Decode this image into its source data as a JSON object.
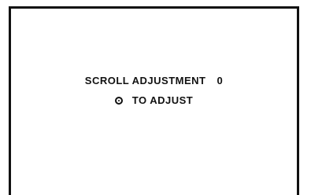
{
  "screen": {
    "title_label": "SCROLL ADJUSTMENT",
    "title_value": "0",
    "instruction_label": "TO ADJUST"
  },
  "icons": {
    "instruction_icon": "radio-button-icon"
  },
  "colors": {
    "background": "#ffffff",
    "foreground": "#111111"
  }
}
